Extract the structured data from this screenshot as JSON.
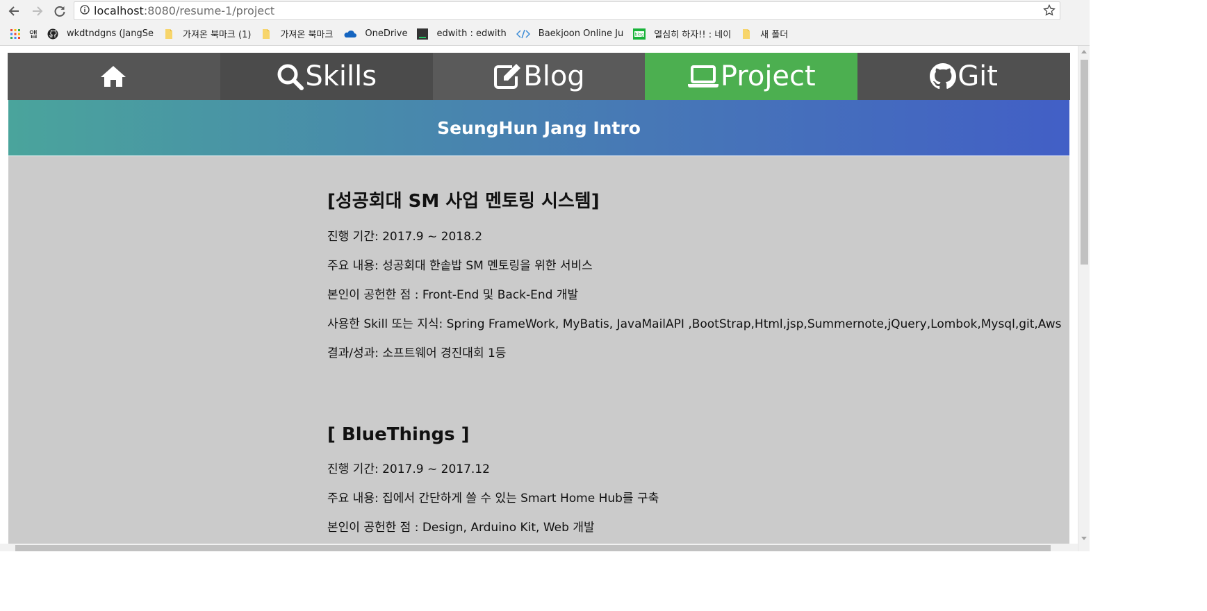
{
  "browser": {
    "url_host": "localhost",
    "url_rest": ":8080/resume-1/project",
    "bookmarks": [
      {
        "label": "앱",
        "icon": "apps-grid-icon"
      },
      {
        "label": "wkdtndgns (JangSe",
        "icon": "github-icon"
      },
      {
        "label": "가져온 북마크 (1)",
        "icon": "folder-icon"
      },
      {
        "label": "가져온 북마크",
        "icon": "folder-icon"
      },
      {
        "label": "OneDrive",
        "icon": "onedrive-cloud-icon"
      },
      {
        "label": "edwith : edwith",
        "icon": "edwith-icon"
      },
      {
        "label": "Baekjoon Online Ju",
        "icon": "code-brackets-icon"
      },
      {
        "label": "열심히 하자!! : 네이",
        "icon": "blog-icon"
      },
      {
        "label": "새 폴더",
        "icon": "folder-icon"
      }
    ]
  },
  "nav": {
    "tabs": [
      {
        "label": "",
        "icon": "home-icon"
      },
      {
        "label": "Skills",
        "icon": "search-icon"
      },
      {
        "label": "Blog",
        "icon": "edit-icon"
      },
      {
        "label": "Project",
        "icon": "laptop-icon"
      },
      {
        "label": "Git",
        "icon": "github-icon"
      }
    ],
    "active_color": "#4caf50"
  },
  "hero": {
    "title": "SeungHun Jang Intro"
  },
  "projects": [
    {
      "title": "[성공회대 SM 사업 멘토링 시스템]",
      "lines": [
        "진행 기간: 2017.9 ~ 2018.2",
        "주요 내용: 성공회대 한솥밥 SM 멘토링을 위한 서비스",
        "본인이 공헌한 점 : Front-End 및 Back-End 개발",
        "사용한 Skill 또는 지식: Spring FrameWork, MyBatis, JavaMailAPI ,BootStrap,Html,jsp,Summernote,jQuery,Lombok,Mysql,git,Aws",
        "결과/성과: 소프트웨어 경진대회 1등"
      ]
    },
    {
      "title": "[ BlueThings ]",
      "lines": [
        "진행 기간: 2017.9 ~ 2017.12",
        "주요 내용: 집에서 간단하게 쓸 수 있는 Smart Home Hub를 구축",
        "본인이 공헌한 점 : Design, Arduino Kit, Web 개발"
      ]
    }
  ]
}
